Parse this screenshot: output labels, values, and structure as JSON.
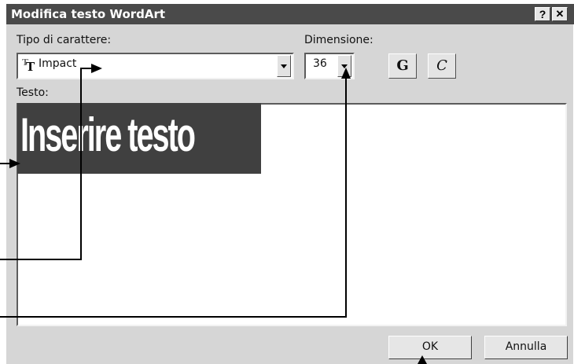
{
  "dialog": {
    "title": "Modifica testo WordArt",
    "help_label": "?",
    "close_label": "✕"
  },
  "font": {
    "label": "Tipo di carattere:",
    "value": "Impact",
    "icon": "truetype-font-icon"
  },
  "size": {
    "label": "Dimensione:",
    "value": "36"
  },
  "format": {
    "bold_label": "G",
    "italic_label": "C"
  },
  "text": {
    "label": "Testo:",
    "value": "Inserire testo"
  },
  "buttons": {
    "ok_label": "OK",
    "cancel_label": "Annulla"
  }
}
